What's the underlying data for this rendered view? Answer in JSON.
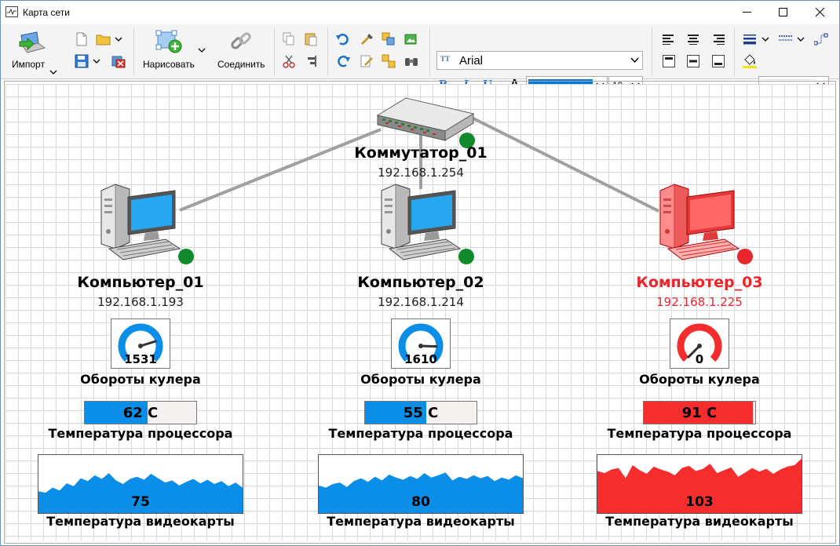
{
  "window": {
    "title": "Карта сети"
  },
  "toolbar": {
    "import_label": "Импорт",
    "draw_label": "Нарисовать",
    "connect_label": "Соединить",
    "font_name": "Arial",
    "font_size": "10",
    "bold": "B",
    "italic": "I",
    "underline": "U",
    "font_color_letter": "A",
    "font_color": "#0078d7"
  },
  "colors": {
    "ok": "#118a2d",
    "alarm": "#e8262c",
    "accent": "#0b8ee8",
    "alarm_fill": "#f52d2d",
    "link": "#9c9c9c"
  },
  "switch": {
    "name": "Коммутатор_01",
    "ip": "192.168.1.254",
    "status": "ok"
  },
  "computers": [
    {
      "name": "Компьютер_01",
      "ip": "192.168.1.193",
      "status": "ok",
      "fan": {
        "label": "Обороты кулера",
        "value": "1531",
        "level": 0.77
      },
      "cpu": {
        "label": "Температура процессора",
        "value": "62 C",
        "level": 0.56
      },
      "gpu": {
        "label": "Температура видеокарты",
        "value": "75",
        "series": [
          30,
          28,
          35,
          31,
          41,
          37,
          48,
          44,
          52,
          47,
          55,
          45,
          40,
          47,
          50,
          46,
          54,
          48,
          42,
          45,
          38,
          43,
          47,
          41,
          46,
          40,
          44,
          37,
          42,
          35
        ]
      }
    },
    {
      "name": "Компьютер_02",
      "ip": "192.168.1.214",
      "status": "ok",
      "fan": {
        "label": "Обороты кулера",
        "value": "1610",
        "level": 0.84
      },
      "cpu": {
        "label": "Температура процессора",
        "value": "55 C",
        "level": 0.55
      },
      "gpu": {
        "label": "Температура видеокарты",
        "value": "80",
        "series": [
          38,
          35,
          40,
          42,
          36,
          44,
          48,
          43,
          50,
          45,
          53,
          49,
          46,
          51,
          47,
          55,
          49,
          52,
          56,
          45,
          50,
          47,
          52,
          48,
          51,
          44,
          49,
          46,
          52,
          48
        ]
      }
    },
    {
      "name": "Компьютер_03",
      "ip": "192.168.1.225",
      "status": "alarm",
      "fan": {
        "label": "Обороты кулера",
        "value": "0",
        "level": 0.0
      },
      "cpu": {
        "label": "Температура процессора",
        "value": "91 C",
        "level": 0.98
      },
      "gpu": {
        "label": "Температура видеокарты",
        "value": "103",
        "series": [
          58,
          55,
          60,
          62,
          48,
          66,
          59,
          54,
          64,
          60,
          57,
          52,
          62,
          65,
          58,
          61,
          68,
          55,
          59,
          63,
          50,
          56,
          62,
          57,
          61,
          54,
          60,
          64,
          66,
          75
        ]
      }
    }
  ]
}
